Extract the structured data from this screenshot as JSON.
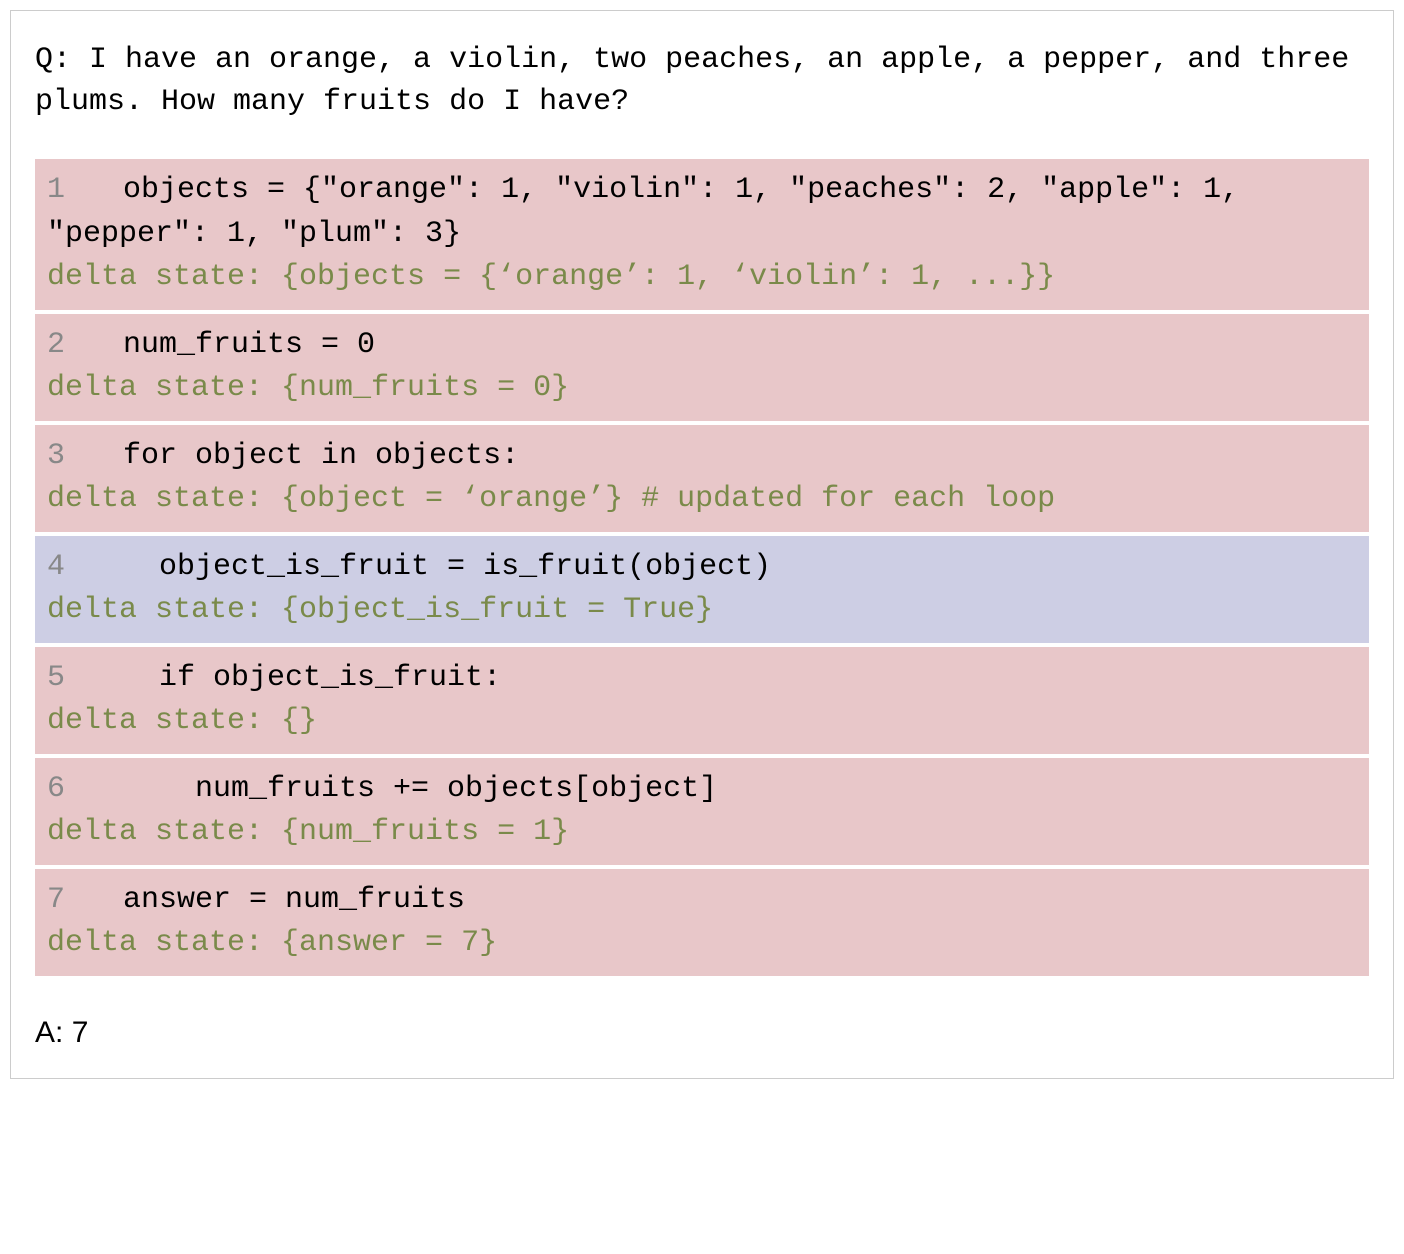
{
  "question": "Q: I have an orange, a violin, two peaches, an apple, a pepper, and three plums. How many fruits do I have?",
  "blocks": [
    {
      "num": "1",
      "code": "  objects = {\"orange\": 1, \"violin\": 1, \"peaches\": 2, \"apple\": 1, \"pepper\": 1, \"plum\": 3}",
      "delta": "delta state: {objects = {‘orange’: 1, ‘violin’: 1, ...}}",
      "color": "red"
    },
    {
      "num": "2",
      "code": "  num_fruits = 0",
      "delta": "delta state: {num_fruits = 0}",
      "color": "red"
    },
    {
      "num": "3",
      "code": "  for object in objects:",
      "delta": "delta state: {object = ‘orange’} # updated for each loop",
      "color": "red"
    },
    {
      "num": "4",
      "code": "    object_is_fruit = is_fruit(object)",
      "delta": "delta state: {object_is_fruit = True}",
      "color": "blue"
    },
    {
      "num": "5",
      "code": "    if object_is_fruit:",
      "delta": "delta state: {}",
      "color": "red"
    },
    {
      "num": "6",
      "code": "      num_fruits += objects[object]",
      "delta": "delta state: {num_fruits = 1}",
      "color": "red"
    },
    {
      "num": "7",
      "code": "  answer = num_fruits",
      "delta": "delta state: {answer = 7}",
      "color": "red"
    }
  ],
  "answer_label": "A: ",
  "answer_value": "7"
}
